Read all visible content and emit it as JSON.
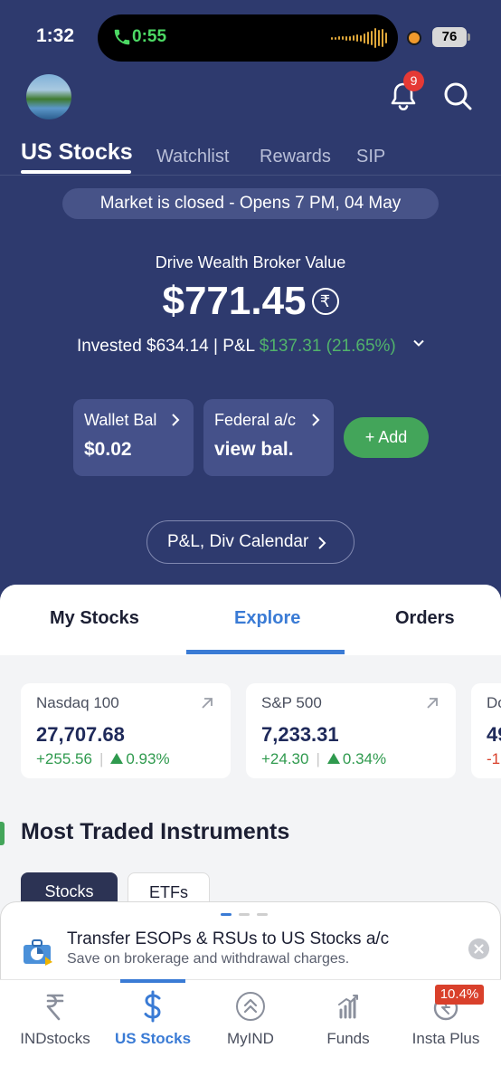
{
  "status_bar": {
    "time": "1:32",
    "call_duration": "0:55",
    "battery": "76"
  },
  "header": {
    "notification_count": "9"
  },
  "tabs": [
    "US Stocks",
    "Watchlist",
    "Rewards",
    "SIP"
  ],
  "market_notice": "Market is closed - Opens 7 PM, 04 May",
  "portfolio": {
    "label": "Drive Wealth Broker Value",
    "value": "$771.45",
    "currency_symbol": "₹",
    "invested_text": "Invested $634.14 | P&L ",
    "pl_text": "$137.31 (21.65%)"
  },
  "wallet": {
    "label": "Wallet Bal",
    "value": "$0.02"
  },
  "federal": {
    "label": "Federal a/c",
    "value": "view bal."
  },
  "add_button": "+ Add",
  "calendar_button": "P&L, Div Calendar",
  "sheet_tabs": [
    "My Stocks",
    "Explore",
    "Orders"
  ],
  "indices": [
    {
      "name": "Nasdaq 100",
      "value": "27,707.68",
      "change": "+255.56",
      "pct": "0.93%"
    },
    {
      "name": "S&P 500",
      "value": "7,233.31",
      "change": "+24.30",
      "pct": "0.34%"
    },
    {
      "name": "Do",
      "value": "49",
      "change": "-1"
    }
  ],
  "section_title": "Most Traded Instruments",
  "chips": [
    "Stocks",
    "ETFs"
  ],
  "banner": {
    "title": "Transfer ESOPs & RSUs to US Stocks a/c",
    "subtitle": "Save on brokerage and withdrawal charges."
  },
  "bottom_nav": [
    {
      "label": "INDstocks",
      "icon": "rupee-icon"
    },
    {
      "label": "US Stocks",
      "icon": "dollar-icon"
    },
    {
      "label": "MyIND",
      "icon": "chevrons-up-icon"
    },
    {
      "label": "Funds",
      "icon": "bar-chart-icon"
    },
    {
      "label": "Insta Plus",
      "icon": "rupee-refresh-icon"
    }
  ],
  "insta_plus_promo": "10.4%",
  "colors": {
    "header_bg": "#2e3a6e",
    "accent": "#3a7bd5",
    "positive": "#2f9a4e",
    "add_button": "#43a55a"
  }
}
